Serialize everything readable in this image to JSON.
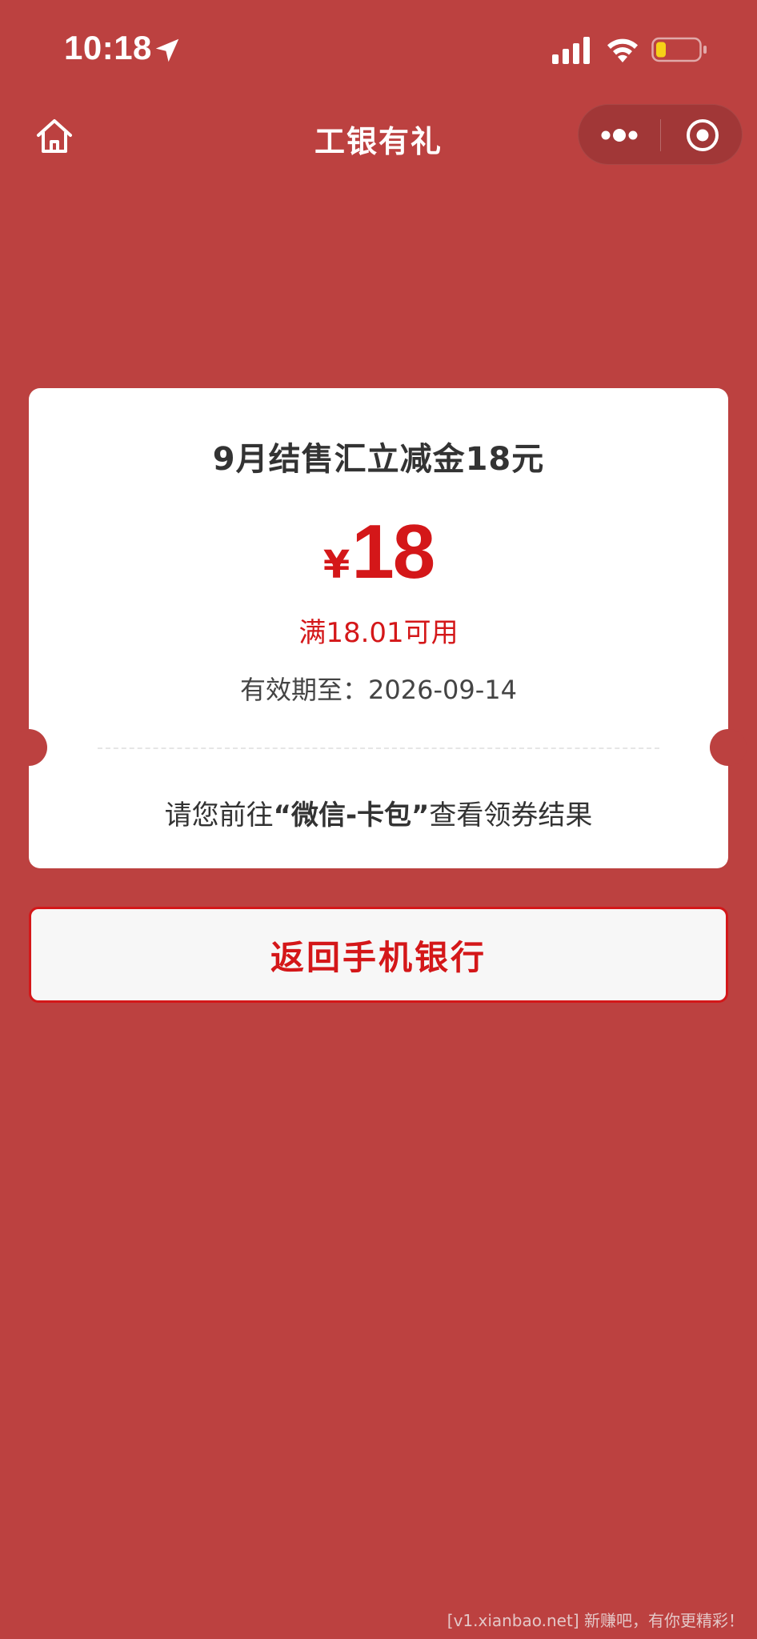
{
  "status_bar": {
    "time": "10:18"
  },
  "nav": {
    "title": "工银有礼"
  },
  "coupon": {
    "title": "9月结售汇立减金18元",
    "currency_symbol": "¥",
    "amount": "18",
    "condition": "满18.01可用",
    "validity": "有效期至：2026-09-14",
    "hint_prefix": "请您前往",
    "hint_highlight": "“微信-卡包”",
    "hint_suffix": "查看领券结果"
  },
  "actions": {
    "return_label": "返回手机银行"
  },
  "watermark": {
    "text": "[v1.xianbao.net] 新赚吧，有你更精彩！"
  },
  "colors": {
    "background": "#bc4140",
    "accent_red": "#d41719",
    "card": "#ffffff"
  }
}
